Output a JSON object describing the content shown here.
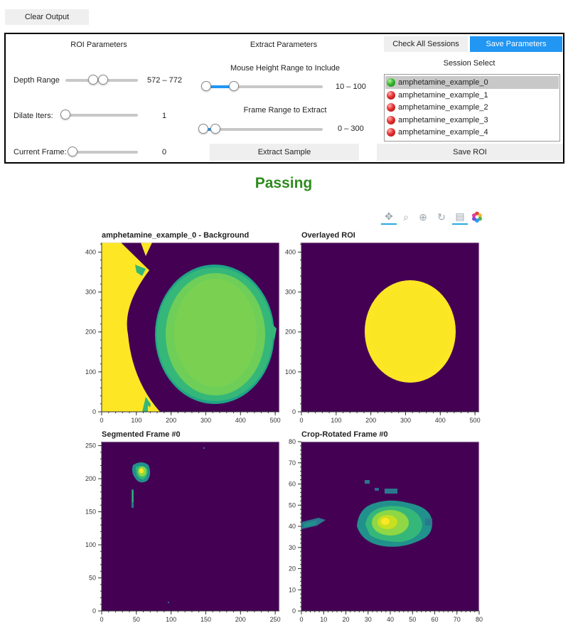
{
  "clear_output_label": "Clear Output",
  "roi": {
    "title": "ROI Parameters",
    "depth_label": "Depth Range",
    "depth_value": "572 – 772",
    "depth_low_pct": 0.38,
    "depth_high_pct": 0.52,
    "dilate_label": "Dilate Iters:",
    "dilate_value": "1",
    "dilate_pct": 0.0,
    "frame_label": "Current Frame:",
    "frame_value": "0",
    "frame_pct": 0.0
  },
  "extract": {
    "title": "Extract Parameters",
    "height_label": "Mouse Height Range to Include",
    "height_value": "10 – 100",
    "height_low_pct": 0.0,
    "height_high_pct": 0.24,
    "frames_label": "Frame Range to Extract",
    "frames_value": "0 – 300",
    "frames_low_pct": 0.0,
    "frames_high_pct": 0.1,
    "extract_button": "Extract Sample"
  },
  "session": {
    "check_all_button": "Check All Sessions",
    "save_params_button": "Save Parameters",
    "select_label": "Session Select",
    "items": [
      {
        "name": "amphetamine_example_0",
        "status": "ok",
        "selected": true
      },
      {
        "name": "amphetamine_example_1",
        "status": "bad",
        "selected": false
      },
      {
        "name": "amphetamine_example_2",
        "status": "bad",
        "selected": false
      },
      {
        "name": "amphetamine_example_3",
        "status": "bad",
        "selected": false
      },
      {
        "name": "amphetamine_example_4",
        "status": "bad",
        "selected": false
      }
    ],
    "save_roi_button": "Save ROI"
  },
  "status_text": "Passing",
  "status_color": "#2e8b1f",
  "toolbar_icons": [
    "pan-icon",
    "box-zoom-icon",
    "wheel-zoom-icon",
    "reset-icon",
    "hover-icon",
    "bokeh-logo-icon"
  ],
  "plots": {
    "background": {
      "title": "amphetamine_example_0 - Background",
      "x_ticks": [
        "0",
        "100",
        "200",
        "300",
        "400",
        "500"
      ],
      "y_ticks": [
        "0",
        "100",
        "200",
        "300",
        "400"
      ]
    },
    "roi": {
      "title": "Overlayed ROI",
      "x_ticks": [
        "0",
        "100",
        "200",
        "300",
        "400",
        "500"
      ],
      "y_ticks": [
        "0",
        "100",
        "200",
        "300",
        "400"
      ]
    },
    "segmented": {
      "title": "Segmented Frame #0",
      "x_ticks": [
        "0",
        "50",
        "100",
        "150",
        "200",
        "250"
      ],
      "y_ticks": [
        "0",
        "50",
        "100",
        "150",
        "200",
        "250"
      ]
    },
    "crop": {
      "title": "Crop-Rotated Frame #0",
      "x_ticks": [
        "0",
        "10",
        "20",
        "30",
        "40",
        "50",
        "60",
        "70",
        "80"
      ],
      "y_ticks": [
        "0",
        "10",
        "20",
        "30",
        "40",
        "50",
        "60",
        "70",
        "80"
      ]
    }
  },
  "colors": {
    "viridis_dark": "#440154",
    "viridis_green": "#7ad151",
    "viridis_yellow": "#fde725",
    "accent": "#2196f3"
  }
}
